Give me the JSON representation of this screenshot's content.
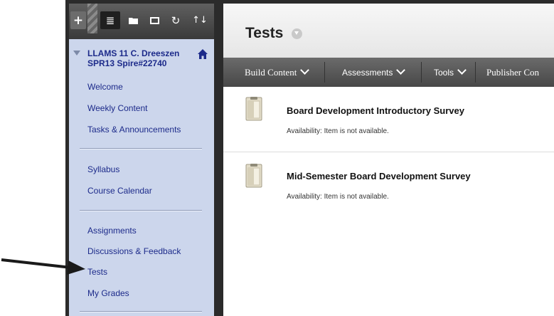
{
  "toolbar": {
    "buttons": [
      {
        "name": "add",
        "icon": "plus-icon",
        "glyph": "+"
      },
      {
        "name": "list-view",
        "icon": "list-icon",
        "glyph": "≣"
      },
      {
        "name": "folder-view",
        "icon": "folder-icon",
        "glyph": "▬"
      },
      {
        "name": "window",
        "icon": "window-icon",
        "glyph": "◼"
      },
      {
        "name": "refresh",
        "icon": "refresh-icon",
        "glyph": "↻"
      },
      {
        "name": "sort",
        "icon": "sort-icon",
        "glyph": "↑↓"
      }
    ]
  },
  "sidebar": {
    "course_title_line1": "LLAMS 11 C. Dreeszen",
    "course_title_line2": "SPR13 Spire#22740",
    "groups": [
      [
        "Welcome",
        "Weekly Content",
        "Tasks & Announcements"
      ],
      [
        "Syllabus",
        "Course Calendar"
      ],
      [
        "Assignments",
        "Discussions & Feedback",
        "Tests",
        "My Grades"
      ]
    ]
  },
  "main": {
    "page_title": "Tests",
    "actions": [
      "Build Content",
      "Assessments",
      "Tools",
      "Publisher Con"
    ],
    "items": [
      {
        "title": "Board Development Introductory Survey",
        "availability_label": "Availability:",
        "availability_value": "Item is not available."
      },
      {
        "title": "Mid-Semester Board Development Survey",
        "availability_label": "Availability:",
        "availability_value": "Item is not available."
      }
    ]
  },
  "colors": {
    "link": "#1c2a8a",
    "sidebar_bg": "#ccd6ec",
    "action_bar": "#575757",
    "frame": "#2b2b2b"
  }
}
